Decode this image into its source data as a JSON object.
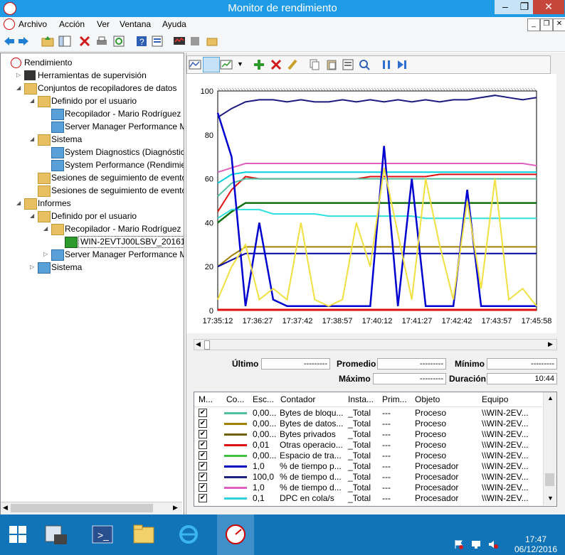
{
  "window": {
    "title": "Monitor de rendimiento"
  },
  "menu": [
    "Archivo",
    "Acción",
    "Ver",
    "Ventana",
    "Ayuda"
  ],
  "tree": [
    {
      "label": "Rendimiento",
      "level": 0
    },
    {
      "label": "Herramientas de supervisión",
      "level": 1
    },
    {
      "label": "Conjuntos de recopiladores de datos",
      "level": 1
    },
    {
      "label": "Definido por el usuario",
      "level": 2
    },
    {
      "label": "Recopilador - Mario Rodríguez",
      "level": 3
    },
    {
      "label": "Server Manager Performance Mo",
      "level": 3
    },
    {
      "label": "Sistema",
      "level": 2
    },
    {
      "label": "System Diagnostics (Diagnóstico",
      "level": 3
    },
    {
      "label": "System Performance (Rendimien",
      "level": 3
    },
    {
      "label": "Sesiones de seguimiento de eventos",
      "level": 2
    },
    {
      "label": "Sesiones de seguimiento de eventos",
      "level": 2
    },
    {
      "label": "Informes",
      "level": 1
    },
    {
      "label": "Definido por el usuario",
      "level": 2
    },
    {
      "label": "Recopilador - Mario Rodríguez",
      "level": 3
    },
    {
      "label": "WIN-2EVTJ00LSBV_20161206-",
      "level": 4
    },
    {
      "label": "Server Manager Performance Mo",
      "level": 3
    },
    {
      "label": "Sistema",
      "level": 2
    }
  ],
  "chart_data": {
    "type": "line",
    "ylim": [
      0,
      100
    ],
    "yticks": [
      "100",
      "80",
      "60",
      "40",
      "20",
      "0"
    ],
    "xticks": [
      "17:35:12",
      "17:36:27",
      "17:37:42",
      "17:38:57",
      "17:40:12",
      "17:41:27",
      "17:42:42",
      "17:43:57",
      "17:45:58"
    ],
    "series": [
      {
        "color": "#1a1a80",
        "values": [
          88,
          92,
          95,
          96,
          96,
          95,
          96,
          95,
          95,
          96,
          95,
          96,
          95,
          96,
          95,
          96,
          95,
          96,
          96,
          97,
          98,
          97,
          96,
          97
        ]
      },
      {
        "color": "#e060c0",
        "values": [
          63,
          65,
          67,
          67,
          67,
          67,
          67,
          67,
          67,
          67,
          67,
          67,
          67,
          67,
          67,
          67,
          67,
          67,
          67,
          67,
          67,
          67,
          67,
          66
        ]
      },
      {
        "color": "#e01010",
        "values": [
          45,
          55,
          61,
          60,
          60,
          60,
          60,
          60,
          60,
          60,
          60,
          61,
          61,
          61,
          61,
          61,
          62,
          62,
          62,
          62,
          62,
          62,
          62,
          62
        ]
      },
      {
        "color": "#00d0e0",
        "values": [
          58,
          62,
          63,
          63,
          63,
          63,
          63,
          63,
          63,
          63,
          63,
          63,
          63,
          63,
          63,
          63,
          63,
          63,
          63,
          63,
          63,
          63,
          63,
          63
        ]
      },
      {
        "color": "#50c0a0",
        "values": [
          52,
          58,
          60,
          60,
          60,
          60,
          60,
          60,
          60,
          60,
          60,
          60,
          60,
          60,
          60,
          60,
          60,
          60,
          60,
          60,
          60,
          60,
          60,
          60
        ]
      },
      {
        "color": "#107010",
        "values": [
          40,
          45,
          49,
          49,
          49,
          49,
          49,
          49,
          49,
          49,
          49,
          49,
          49,
          49,
          49,
          49,
          49,
          49,
          49,
          49,
          49,
          49,
          49,
          49
        ]
      },
      {
        "color": "#30e0e0",
        "values": [
          42,
          46,
          46,
          46,
          44,
          44,
          44,
          44,
          43,
          43,
          43,
          43,
          43,
          43,
          43,
          42,
          42,
          42,
          42,
          42,
          42,
          42,
          42,
          42
        ]
      },
      {
        "color": "#a08000",
        "values": [
          20,
          25,
          29,
          29,
          29,
          29,
          29,
          29,
          29,
          29,
          29,
          29,
          29,
          29,
          29,
          29,
          29,
          29,
          29,
          29,
          29,
          29,
          29,
          29
        ]
      },
      {
        "color": "#0000a0",
        "values": [
          20,
          23,
          26,
          26,
          26,
          26,
          26,
          26,
          26,
          26,
          26,
          26,
          26,
          26,
          26,
          26,
          26,
          26,
          26,
          26,
          26,
          26,
          26,
          26
        ]
      },
      {
        "color": "#0000d0",
        "values": [
          90,
          70,
          2,
          40,
          5,
          2,
          2,
          2,
          2,
          2,
          2,
          2,
          75,
          2,
          60,
          2,
          2,
          2,
          55,
          2,
          2,
          2,
          2,
          2
        ]
      },
      {
        "color": "#f0e040",
        "values": [
          5,
          20,
          30,
          5,
          10,
          5,
          40,
          5,
          2,
          5,
          40,
          20,
          65,
          35,
          5,
          60,
          30,
          5,
          50,
          10,
          60,
          5,
          10,
          2
        ]
      }
    ]
  },
  "stats": {
    "ultimo_label": "Último",
    "ultimo_value": "---------",
    "promedio_label": "Promedio",
    "promedio_value": "---------",
    "minimo_label": "Mínimo",
    "minimo_value": "---------",
    "maximo_label": "Máximo",
    "maximo_value": "---------",
    "duracion_label": "Duración",
    "duracion_value": "10:44"
  },
  "table": {
    "headers": [
      "M...",
      "Co...",
      "Esc...",
      "Contador",
      "Insta...",
      "Prim...",
      "Objeto",
      "Equipo"
    ],
    "rows": [
      {
        "color": "#50c0a0",
        "scale": "0,00...",
        "counter": "Bytes de bloqu...",
        "instance": "_Total",
        "parent": "---",
        "object": "Proceso",
        "computer": "\\\\WIN-2EV..."
      },
      {
        "color": "#a08000",
        "scale": "0,00...",
        "counter": "Bytes de datos...",
        "instance": "_Total",
        "parent": "---",
        "object": "Proceso",
        "computer": "\\\\WIN-2EV..."
      },
      {
        "color": "#706000",
        "scale": "0,00...",
        "counter": "Bytes privados",
        "instance": "_Total",
        "parent": "---",
        "object": "Proceso",
        "computer": "\\\\WIN-2EV..."
      },
      {
        "color": "#e01010",
        "scale": "0,01",
        "counter": "Otras operacio...",
        "instance": "_Total",
        "parent": "---",
        "object": "Proceso",
        "computer": "\\\\WIN-2EV..."
      },
      {
        "color": "#40c040",
        "scale": "0,00...",
        "counter": "Espacio de tra...",
        "instance": "_Total",
        "parent": "---",
        "object": "Proceso",
        "computer": "\\\\WIN-2EV..."
      },
      {
        "color": "#0000c0",
        "scale": "1,0",
        "counter": "% de tiempo p...",
        "instance": "_Total",
        "parent": "---",
        "object": "Procesador",
        "computer": "\\\\WIN-2EV..."
      },
      {
        "color": "#202080",
        "scale": "100,0",
        "counter": "% de tiempo d...",
        "instance": "_Total",
        "parent": "---",
        "object": "Procesador",
        "computer": "\\\\WIN-2EV..."
      },
      {
        "color": "#e060c0",
        "scale": "1,0",
        "counter": "% de tiempo d...",
        "instance": "_Total",
        "parent": "---",
        "object": "Procesador",
        "computer": "\\\\WIN-2EV..."
      },
      {
        "color": "#30d0e0",
        "scale": "0,1",
        "counter": "DPC en cola/s",
        "instance": "_Total",
        "parent": "---",
        "object": "Procesador",
        "computer": "\\\\WIN-2EV..."
      }
    ]
  },
  "taskbar": {
    "time": "17:47",
    "date": "06/12/2016"
  }
}
